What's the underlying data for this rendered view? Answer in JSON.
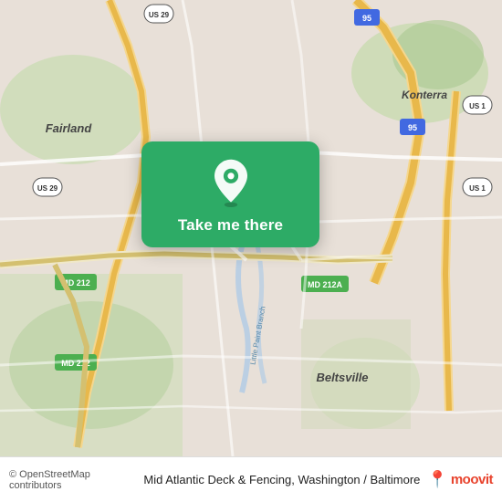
{
  "map": {
    "attribution": "© OpenStreetMap contributors",
    "background_color": "#e8e0d8"
  },
  "cta": {
    "label": "Take me there",
    "pin_icon": "location-pin-icon"
  },
  "footer": {
    "place": "Mid Atlantic Deck & Fencing, Washington / Baltimore",
    "moovit_label": "moovit"
  },
  "roads": {
    "labels": [
      "Fairland",
      "Konterra",
      "Beltsville",
      "US 29",
      "US 1",
      "MD 212",
      "MD 212A",
      "I-95",
      "US 29"
    ]
  }
}
